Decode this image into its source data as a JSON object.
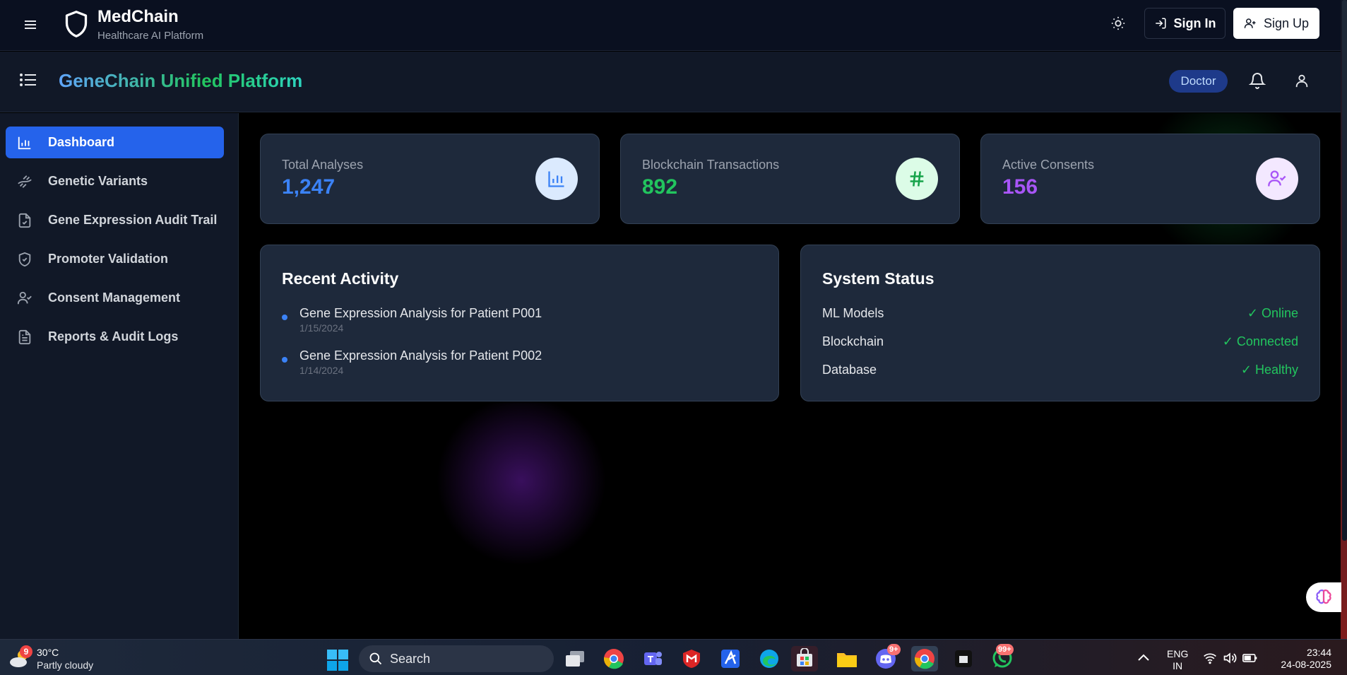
{
  "brand": {
    "name": "MedChain",
    "subtitle": "Healthcare AI Platform"
  },
  "auth": {
    "sign_in": "Sign In",
    "sign_up": "Sign Up"
  },
  "subheader": {
    "title": "GeneChain Unified Platform",
    "role_badge": "Doctor"
  },
  "sidebar": {
    "items": [
      {
        "label": "Dashboard",
        "icon": "bar-chart-icon",
        "active": true
      },
      {
        "label": "Genetic Variants",
        "icon": "dna-icon"
      },
      {
        "label": "Gene Expression Audit Trail",
        "icon": "file-check-icon"
      },
      {
        "label": "Promoter Validation",
        "icon": "shield-check-icon"
      },
      {
        "label": "Consent Management",
        "icon": "user-check-icon"
      },
      {
        "label": "Reports & Audit Logs",
        "icon": "file-text-icon"
      }
    ]
  },
  "stats": [
    {
      "label": "Total Analyses",
      "value": "1,247",
      "color": "#3b82f6",
      "icon": "bar-chart-icon"
    },
    {
      "label": "Blockchain Transactions",
      "value": "892",
      "color": "#22c55e",
      "icon": "hash-icon"
    },
    {
      "label": "Active Consents",
      "value": "156",
      "color": "#a855f7",
      "icon": "user-check-icon"
    }
  ],
  "recent_activity": {
    "title": "Recent Activity",
    "items": [
      {
        "title": "Gene Expression Analysis for Patient P001",
        "date": "1/15/2024"
      },
      {
        "title": "Gene Expression Analysis for Patient P002",
        "date": "1/14/2024"
      }
    ]
  },
  "system_status": {
    "title": "System Status",
    "rows": [
      {
        "name": "ML Models",
        "value": "✓ Online"
      },
      {
        "name": "Blockchain",
        "value": "✓ Connected"
      },
      {
        "name": "Database",
        "value": "✓ Healthy"
      }
    ]
  },
  "taskbar": {
    "weather": {
      "badge": "9",
      "temp": "30°C",
      "condition": "Partly cloudy"
    },
    "search_label": "Search",
    "badges": {
      "discord": "9+",
      "whatsapp": "99+"
    },
    "lang": {
      "line1": "ENG",
      "line2": "IN"
    },
    "time": "23:44",
    "date": "24-08-2025"
  }
}
